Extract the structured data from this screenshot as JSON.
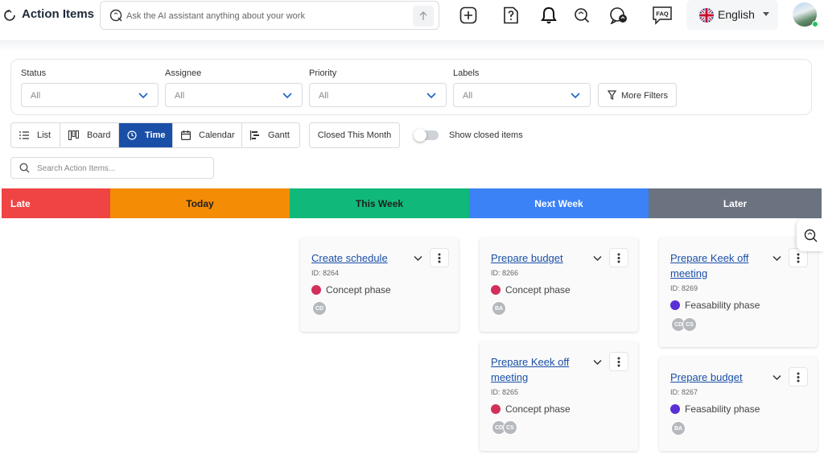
{
  "header": {
    "title": "Action Items",
    "ai_placeholder": "Ask the AI assistant anything about your work",
    "language": "English",
    "faq_label": "FAQ"
  },
  "filters": {
    "status": {
      "label": "Status",
      "value": "All"
    },
    "assignee": {
      "label": "Assignee",
      "value": "All"
    },
    "priority": {
      "label": "Priority",
      "value": "All"
    },
    "labels": {
      "label": "Labels",
      "value": "All"
    },
    "more_filters": "More Filters"
  },
  "views": {
    "list": "List",
    "board": "Board",
    "time": "Time",
    "calendar": "Calendar",
    "gantt": "Gantt",
    "active": "Time"
  },
  "closed_this_month": "Closed This Month",
  "show_closed": {
    "label": "Show closed items",
    "on": false
  },
  "search_placeholder": "Search Action Items...",
  "columns": [
    {
      "title": "Late",
      "color": "#ef4444",
      "text_color": "#ffffff"
    },
    {
      "title": "Today",
      "color": "#f48c06",
      "text_color": "#1f1f1f"
    },
    {
      "title": "This Week",
      "color": "#10b97a",
      "text_color": "#1f1f1f"
    },
    {
      "title": "Next Week",
      "color": "#3b82f6",
      "text_color": "#ffffff"
    },
    {
      "title": "Later",
      "color": "#6b7280",
      "text_color": "#ffffff"
    }
  ],
  "phase_colors": {
    "concept": "#d1305b",
    "feasability": "#5b2fd6"
  },
  "cards": {
    "this_week_1": {
      "title": "Create schedule",
      "id": "ID: 8264",
      "phase": "Concept phase",
      "assignees": [
        "CD"
      ]
    },
    "next_week_1": {
      "title": "Prepare budget",
      "id": "ID: 8266",
      "phase": "Concept phase",
      "assignees": [
        "BA"
      ]
    },
    "next_week_2": {
      "title": "Prepare Keek off meeting",
      "id": "ID: 8265",
      "phase": "Concept phase",
      "assignees": [
        "CD",
        "CS"
      ]
    },
    "later_1": {
      "title": "Prepare Keek off meeting",
      "id": "ID: 8269",
      "phase": "Feasability phase",
      "assignees": [
        "CD",
        "CS"
      ]
    },
    "later_2": {
      "title": "Prepare budget",
      "id": "ID: 8267",
      "phase": "Feasability phase",
      "assignees": [
        "BA"
      ]
    }
  }
}
